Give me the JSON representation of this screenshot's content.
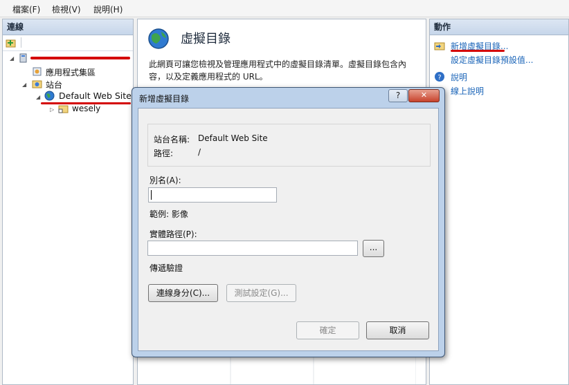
{
  "menu": {
    "file": "檔案(F)",
    "view": "檢視(V)",
    "help": "說明(H)"
  },
  "connections": {
    "header": "連線",
    "tree": {
      "app_pools": "應用程式集區",
      "sites": "站台",
      "default_site": "Default Web Site",
      "child": "wesely"
    }
  },
  "main": {
    "title": "虛擬目錄",
    "description_line1": "此網頁可讓您檢視及管理應用程式中的虛擬目錄清單。虛擬目錄包含內",
    "description_line2": "容，以及定義應用程式的 URL。"
  },
  "actions": {
    "header": "動作",
    "items": [
      "新增虛擬目錄...",
      "設定虛擬目錄預設值...",
      "說明",
      "線上說明"
    ]
  },
  "dialog": {
    "title": "新增虛擬目錄",
    "help_glyph": "?",
    "close_glyph": "✕",
    "site_name_label": "站台名稱:",
    "site_name_value": "Default Web Site",
    "path_label": "路徑:",
    "path_value": "/",
    "alias_label": "別名(A):",
    "alias_value": "",
    "example": "範例: 影像",
    "physical_path_label": "實體路徑(P):",
    "physical_path_value": "",
    "browse_label": "...",
    "passthrough": "傳遞驗證",
    "connect_as": "連線身分(C)...",
    "test_settings": "測試設定(G)...",
    "ok": "確定",
    "cancel": "取消"
  },
  "colors": {
    "accent_link": "#1a64b8",
    "annotation_red": "#d40000"
  }
}
